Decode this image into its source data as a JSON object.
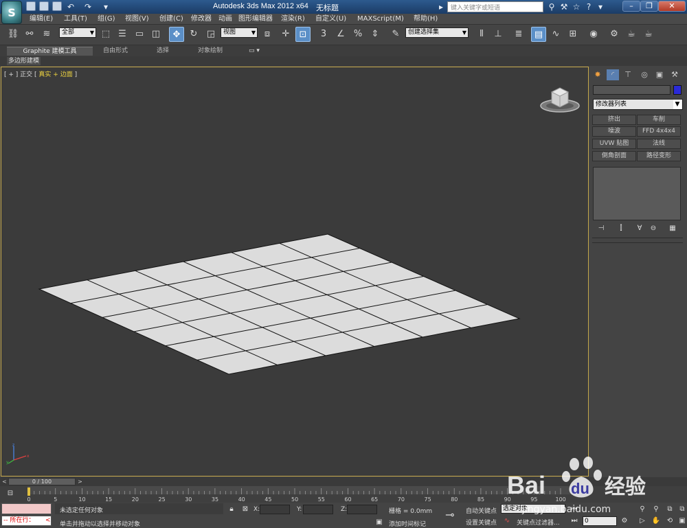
{
  "titlebar": {
    "logo": "S",
    "app_title": "Autodesk 3ds Max  2012 x64",
    "doc_title": "无标题",
    "search_placeholder": "键入关键字或短语",
    "icons": [
      "binoculars-icon",
      "tools-icon",
      "star-icon",
      "help-icon"
    ]
  },
  "menu": [
    "编辑(E)",
    "工具(T)",
    "组(G)",
    "视图(V)",
    "创建(C)",
    "修改器",
    "动画",
    "图形编辑器",
    "渲染(R)",
    "自定义(U)",
    "MAXScript(M)",
    "帮助(H)"
  ],
  "toolbar": {
    "selection_filter": "全部",
    "ref_coord": "视图",
    "named_selection": "创建选择集"
  },
  "ribbon": {
    "tabs": [
      "Graphite 建模工具",
      "自由形式",
      "选择",
      "对象绘制"
    ],
    "subtab": "多边形建模"
  },
  "viewport": {
    "label_prefix": "[ + ] ",
    "label_view": "正交",
    "label_shade": " [ 真实 + 边面 ]",
    "label_shade_a": "真实",
    "label_shade_b": "边面"
  },
  "command_panel": {
    "modifier_list": "修改器列表",
    "buttons": [
      "挤出",
      "车削",
      "噪波",
      "FFD 4x4x4",
      "UVW 贴图",
      "法线",
      "倒角剖面",
      "路径变形"
    ]
  },
  "timeline": {
    "slider_label": "0 / 100",
    "ticks": [
      "0",
      "5",
      "10",
      "15",
      "20",
      "25",
      "30",
      "35",
      "40",
      "45",
      "50",
      "55",
      "60",
      "65",
      "70",
      "75",
      "80",
      "85",
      "90",
      "95",
      "100"
    ]
  },
  "status": {
    "maxscript_text": "所在行：",
    "selection_info": "未选定任何对象",
    "prompt": "单击并拖动以选择并移动对象",
    "x_label": "X:",
    "y_label": "Y:",
    "z_label": "Z:",
    "grid": "栅格 = 0.0mm",
    "add_time_tag": "添加时间标记",
    "auto_key": "自动关键点",
    "set_key": "设置关键点",
    "selected_object": "选定对象",
    "key_filters": "关键点过滤器...",
    "frame_value": "0"
  },
  "watermark": {
    "brand": "Bai",
    "brand_tail": "du",
    "cn": "经验",
    "url": "jingyan.baidu.com"
  }
}
